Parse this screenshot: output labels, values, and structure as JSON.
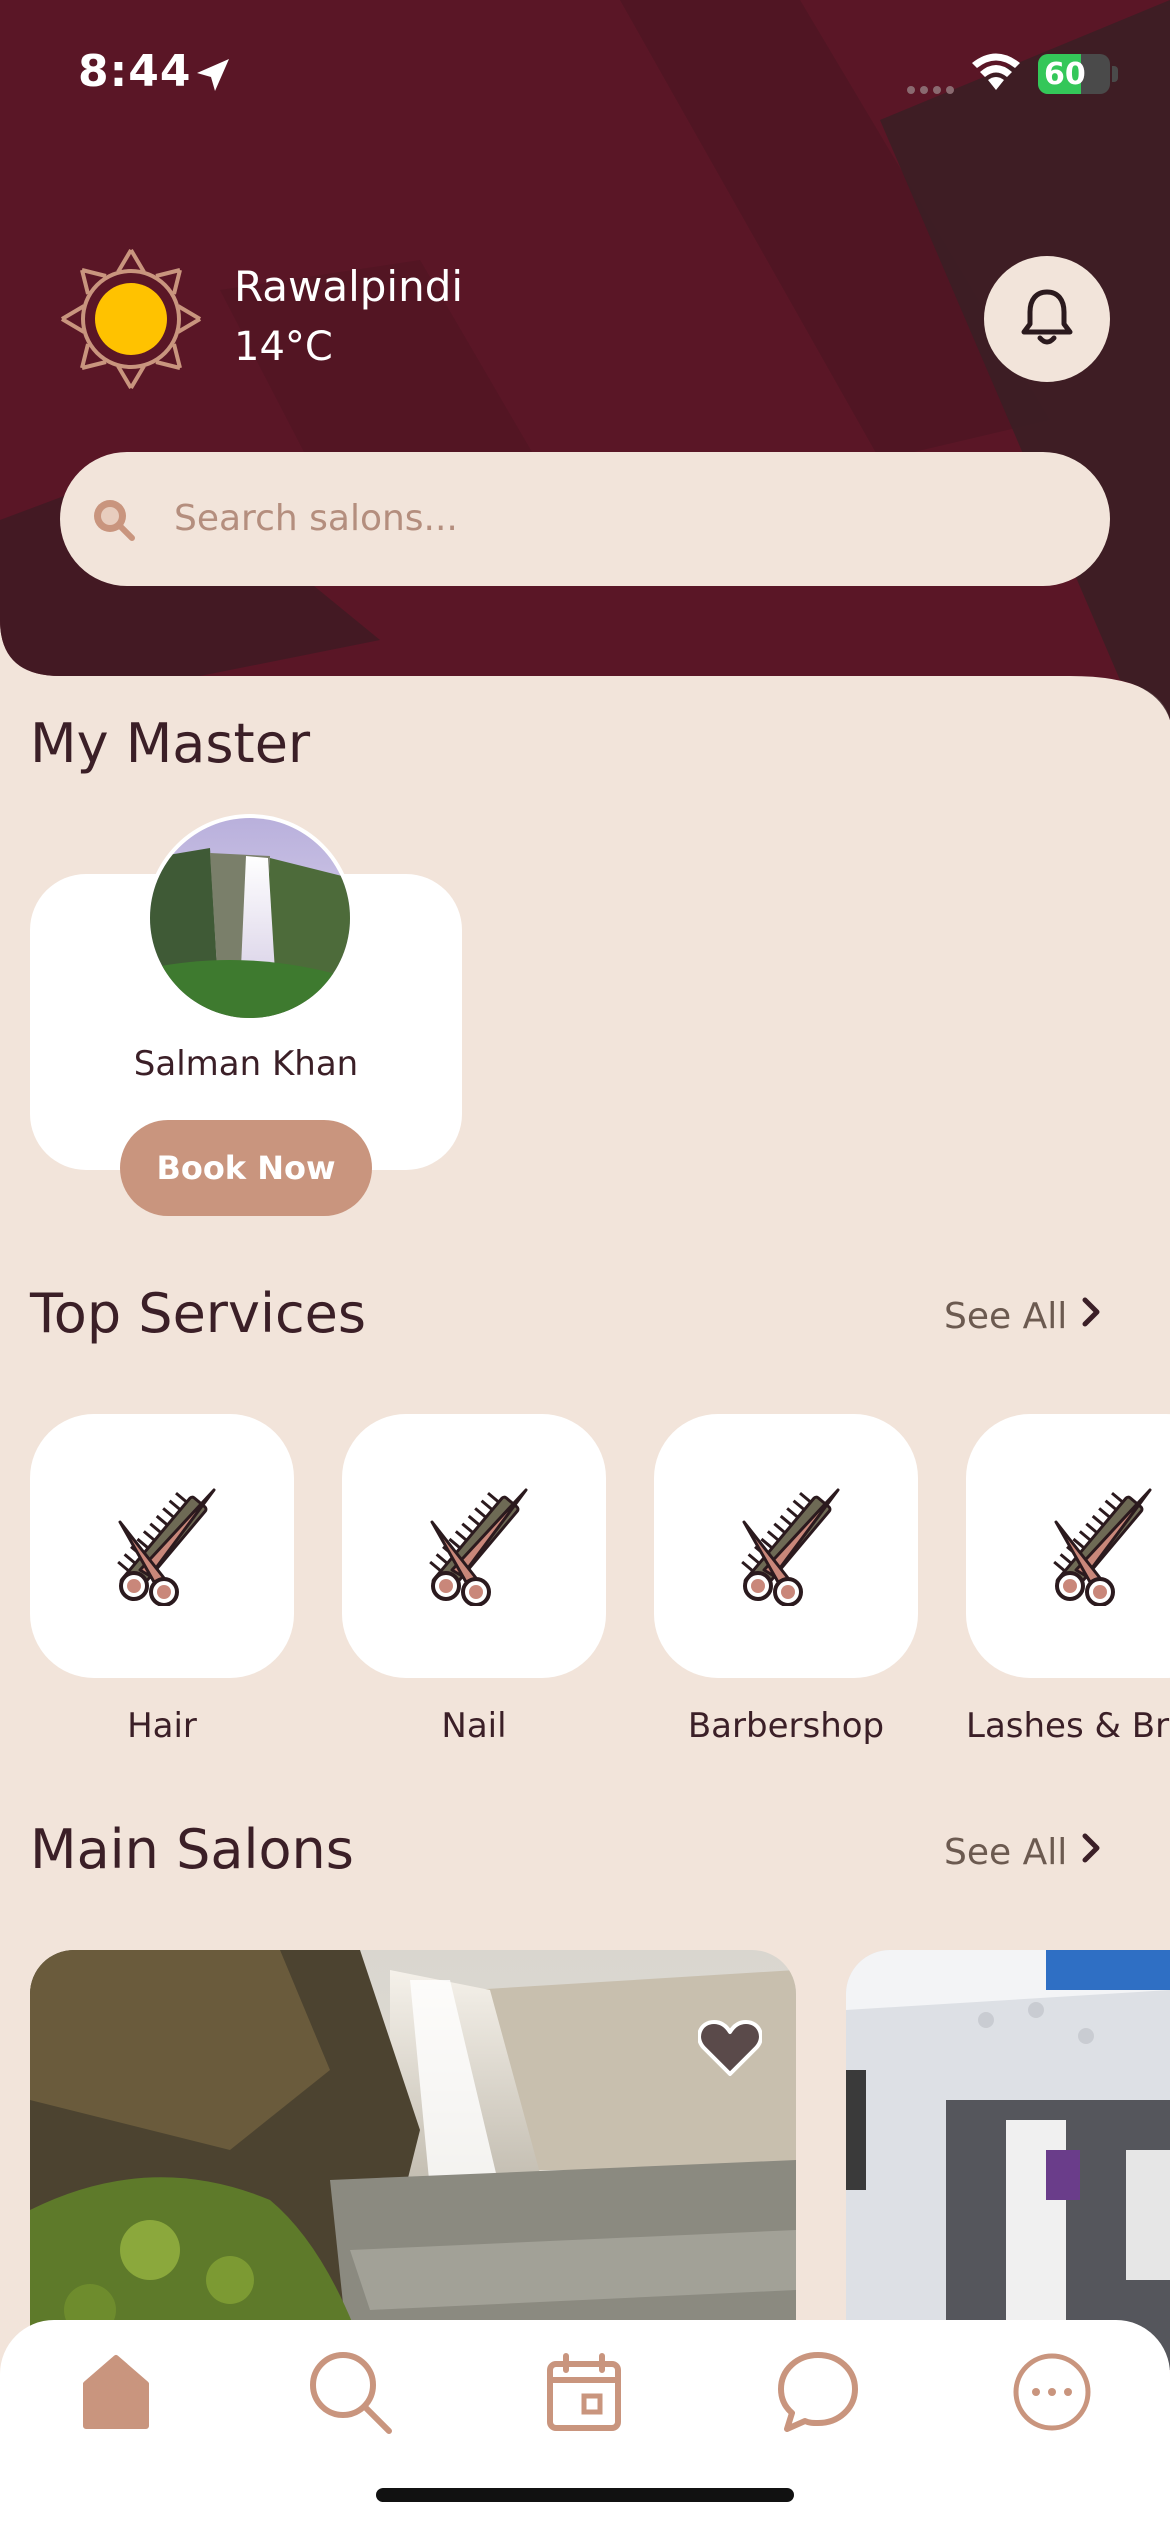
{
  "status_bar": {
    "time": "8:44",
    "battery": "60",
    "battery_level": 0.6
  },
  "header": {
    "city": "Rawalpindi",
    "temperature": "14°C",
    "weather_icon": "sun-icon",
    "notification_icon": "bell-icon",
    "background_color": "#5A1626"
  },
  "search": {
    "placeholder": "Search salons..."
  },
  "my_master": {
    "title": "My Master",
    "master": {
      "name": "Salman Khan",
      "book_label": "Book Now"
    }
  },
  "top_services": {
    "title": "Top Services",
    "see_all": "See All",
    "items": [
      {
        "label": "Hair",
        "icon": "scissors-comb-icon"
      },
      {
        "label": "Nail",
        "icon": "scissors-comb-icon"
      },
      {
        "label": "Barbershop",
        "icon": "scissors-comb-icon"
      },
      {
        "label": "Lashes & Bro",
        "icon": "scissors-comb-icon"
      }
    ]
  },
  "main_salons": {
    "title": "Main Salons",
    "see_all": "See All"
  },
  "bottom_nav": [
    {
      "name": "home",
      "icon": "home-icon",
      "active": true
    },
    {
      "name": "search",
      "icon": "search-icon",
      "active": false
    },
    {
      "name": "calendar",
      "icon": "calendar-icon",
      "active": false
    },
    {
      "name": "chat",
      "icon": "chat-icon",
      "active": false
    },
    {
      "name": "more",
      "icon": "more-icon",
      "active": false
    }
  ],
  "colors": {
    "accent": "#C9957E",
    "background": "#F2E4DA",
    "header": "#5A1626",
    "text_dark": "#3B1F27"
  }
}
